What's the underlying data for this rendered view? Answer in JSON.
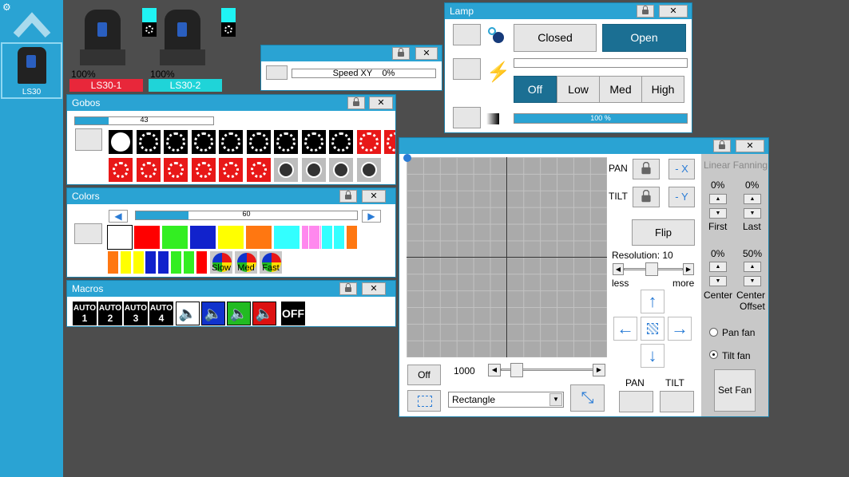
{
  "sidebar": {
    "fixture_label": "LS30",
    "home_icon": "chevron-up-icon",
    "settings_icon": "gear-icon"
  },
  "fixtures": [
    {
      "label": "LS30-1",
      "percent": "100%",
      "color": "#e8273a"
    },
    {
      "label": "LS30-2",
      "percent": "100%",
      "color": "#1fd4d8"
    }
  ],
  "speed": {
    "label": "Speed XY",
    "value": "0%"
  },
  "gobos": {
    "title": "Gobos",
    "slider_value": "43",
    "slider_fraction": 0.24
  },
  "colors": {
    "title": "Colors",
    "slider_value": "60",
    "slider_fraction": 0.24,
    "row1": [
      "#ffffff",
      "#ff0000",
      "#33ee22",
      "#1122cc",
      "#ffff00",
      "#ff7711",
      "#33ffff",
      "#ff88ee"
    ],
    "row1b": [
      "#ff88ee",
      "#33ffff",
      "#33ffff",
      "#ff7711"
    ],
    "row2": [
      "#ff7711",
      "#ffff00",
      "#ffff00",
      "#1122cc",
      "#1122cc",
      "#33ee22",
      "#33ee22",
      "#ff0000"
    ],
    "wheels": [
      "Slow",
      "Med",
      "Fast"
    ]
  },
  "macros": {
    "title": "Macros",
    "auto": [
      {
        "top": "AUTO",
        "num": "1"
      },
      {
        "top": "AUTO",
        "num": "2"
      },
      {
        "top": "AUTO",
        "num": "3"
      },
      {
        "top": "AUTO",
        "num": "4"
      }
    ],
    "off_label": "OFF",
    "speaker_colors": [
      "#ffffff",
      "#1133cc",
      "#22bb22",
      "#dd1111"
    ]
  },
  "lamp": {
    "title": "Lamp",
    "closed": "Closed",
    "open": "Open",
    "fan": {
      "off": "Off",
      "low": "Low",
      "med": "Med",
      "high": "High"
    },
    "dimmer": "100 %",
    "dimmer_fraction": 1.0
  },
  "movement": {
    "pan_label": "PAN",
    "tilt_label": "TILT",
    "pan_invert": "- X",
    "tilt_invert": "- Y",
    "flip": "Flip",
    "resolution": "Resolution: 10",
    "less": "less",
    "more": "more",
    "off": "Off",
    "size_value": "1000",
    "shape": "Rectangle",
    "pan_bottom": "PAN",
    "tilt_bottom": "TILT",
    "linear_fanning": "Linear Fanning",
    "first_pct": "0%",
    "last_pct": "0%",
    "first": "First",
    "last": "Last",
    "center_pct": "0%",
    "offset_pct": "50%",
    "center": "Center",
    "center_offset_1": "Center",
    "center_offset_2": "Offset",
    "pan_fan": "Pan fan",
    "tilt_fan": "Tilt fan",
    "set_fan": "Set Fan"
  }
}
